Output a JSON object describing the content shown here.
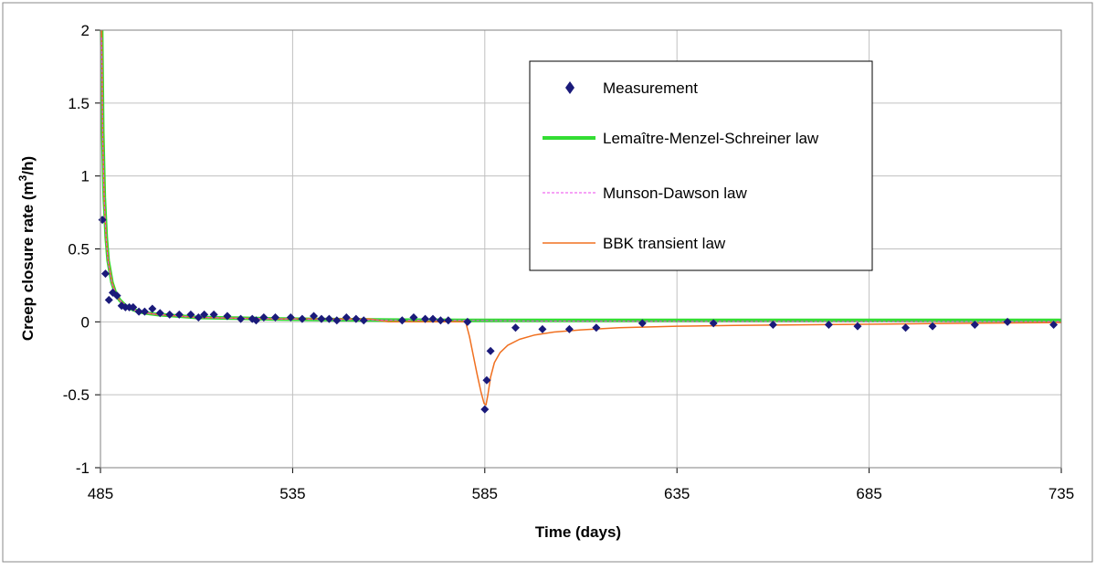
{
  "chart_data": {
    "type": "scatter",
    "xlabel": "Time (days)",
    "ylabel_main": "Creep closure rate (m",
    "ylabel_sup": "3",
    "ylabel_end": "/h)",
    "xlim": [
      485,
      735
    ],
    "ylim": [
      -1,
      2
    ],
    "x_ticks": [
      485,
      535,
      585,
      635,
      685,
      735
    ],
    "x_tick_labels": [
      "485",
      "535",
      "585",
      "635",
      "685",
      "735"
    ],
    "y_ticks": [
      2,
      1.5,
      1,
      0.5,
      0,
      -0.5,
      -1
    ],
    "y_tick_labels": [
      "2",
      "1.5",
      "1",
      "0.5",
      "0",
      "-0.5",
      "-1"
    ],
    "grid": true,
    "legend_position": "top-right",
    "colors": {
      "measurement": "#1a1a7a",
      "lms": "#33dd33",
      "md": "#ee44ee",
      "bbk": "#f07020",
      "grid": "#c0c0c0"
    },
    "series": [
      {
        "name": "Measurement",
        "kind": "markers",
        "x": [
          485.5,
          486.3,
          487.2,
          488.2,
          489.3,
          490.5,
          491.5,
          492.5,
          493.5,
          495.0,
          496.5,
          498.5,
          500.5,
          503.0,
          505.5,
          508.5,
          510.5,
          512.0,
          514.5,
          518.0,
          521.5,
          524.5,
          525.5,
          527.5,
          530.5,
          534.5,
          537.5,
          540.5,
          542.5,
          544.5,
          546.5,
          549.0,
          551.5,
          553.5,
          563.5,
          566.5,
          569.5,
          571.5,
          573.5,
          575.5,
          580.5,
          585.0,
          585.5,
          586.5,
          593.0,
          600.0,
          607.0,
          614.0,
          626.0,
          644.5,
          660.0,
          674.5,
          682.0,
          694.5,
          701.5,
          712.5,
          721.0,
          733.0
        ],
        "y": [
          0.7,
          0.33,
          0.15,
          0.2,
          0.18,
          0.11,
          0.1,
          0.1,
          0.1,
          0.07,
          0.07,
          0.09,
          0.06,
          0.05,
          0.05,
          0.05,
          0.03,
          0.05,
          0.05,
          0.04,
          0.02,
          0.02,
          0.01,
          0.03,
          0.03,
          0.03,
          0.02,
          0.04,
          0.02,
          0.02,
          0.01,
          0.03,
          0.02,
          0.01,
          0.01,
          0.03,
          0.02,
          0.02,
          0.01,
          0.01,
          0.0,
          -0.6,
          -0.4,
          -0.2,
          -0.04,
          -0.05,
          -0.05,
          -0.04,
          -0.01,
          -0.01,
          -0.02,
          -0.02,
          -0.03,
          -0.04,
          -0.03,
          -0.02,
          0.0,
          -0.02
        ]
      },
      {
        "name": "Lemaître-Menzel-Schreiner law",
        "kind": "line",
        "x": [
          485.3,
          485.6,
          486.0,
          486.5,
          487.0,
          488.0,
          489.0,
          490.0,
          491.5,
          493.0,
          495.0,
          497.0,
          500.0,
          505.0,
          510.0,
          520.0,
          530.0,
          545.0,
          560.0,
          580.0,
          600.0,
          650.0,
          700.0,
          735.0
        ],
        "y": [
          2.0,
          1.3,
          0.85,
          0.58,
          0.42,
          0.27,
          0.19,
          0.15,
          0.11,
          0.09,
          0.07,
          0.06,
          0.05,
          0.04,
          0.03,
          0.025,
          0.02,
          0.015,
          0.012,
          0.01,
          0.01,
          0.01,
          0.01,
          0.01
        ]
      },
      {
        "name": "Munson-Dawson law",
        "kind": "line",
        "x": [
          485.3,
          485.6,
          486.0,
          486.5,
          487.0,
          488.0,
          489.0,
          490.0,
          491.5,
          493.0,
          495.0,
          497.0,
          500.0,
          505.0,
          510.0,
          520.0,
          530.0,
          545.0,
          560.0,
          580.0,
          600.0,
          650.0,
          700.0,
          735.0
        ],
        "y": [
          1.95,
          1.25,
          0.82,
          0.56,
          0.41,
          0.26,
          0.19,
          0.15,
          0.11,
          0.09,
          0.07,
          0.06,
          0.05,
          0.04,
          0.03,
          0.025,
          0.02,
          0.015,
          0.012,
          0.01,
          0.005,
          0.003,
          0.002,
          0.002
        ]
      },
      {
        "name": "BBK transient law",
        "kind": "line",
        "x": [
          485.3,
          485.6,
          486.0,
          486.5,
          487.0,
          488.0,
          489.0,
          490.0,
          491.5,
          493.0,
          495.0,
          497.0,
          500.0,
          505.0,
          510.0,
          520.0,
          530.0,
          545.0,
          555.0,
          560.0,
          570.0,
          580.0,
          581.0,
          582.0,
          583.0,
          584.0,
          584.8,
          585.3,
          585.8,
          586.5,
          587.5,
          589.0,
          591.0,
          594.0,
          598.0,
          603.0,
          610.0,
          620.0,
          635.0,
          650.0,
          670.0,
          690.0,
          710.0,
          735.0
        ],
        "y": [
          2.0,
          1.25,
          0.83,
          0.57,
          0.42,
          0.27,
          0.19,
          0.15,
          0.11,
          0.09,
          0.07,
          0.06,
          0.05,
          0.04,
          0.03,
          0.025,
          0.02,
          0.02,
          0.02,
          0.0,
          0.0,
          0.0,
          -0.1,
          -0.23,
          -0.36,
          -0.48,
          -0.56,
          -0.57,
          -0.5,
          -0.38,
          -0.28,
          -0.21,
          -0.16,
          -0.12,
          -0.09,
          -0.07,
          -0.055,
          -0.04,
          -0.03,
          -0.025,
          -0.02,
          -0.015,
          -0.01,
          -0.005
        ]
      }
    ]
  }
}
